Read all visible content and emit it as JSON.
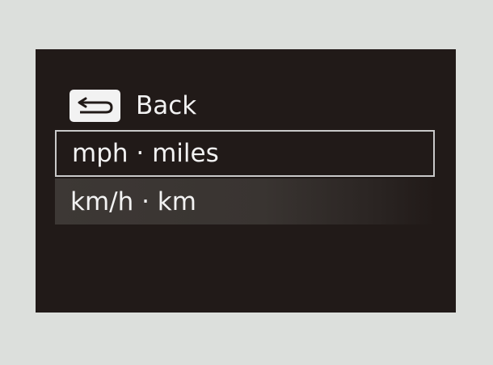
{
  "menu": {
    "back_label": "Back",
    "back_icon": "return-arrow-icon",
    "items": [
      {
        "label": "mph · miles",
        "selected": true
      },
      {
        "label": "km/h · km",
        "selected": false
      }
    ]
  },
  "colors": {
    "screen_background": "#211a18",
    "page_background": "#dcdfdc",
    "text": "#f2f2f2",
    "selection_border": "#c9c9c9"
  }
}
